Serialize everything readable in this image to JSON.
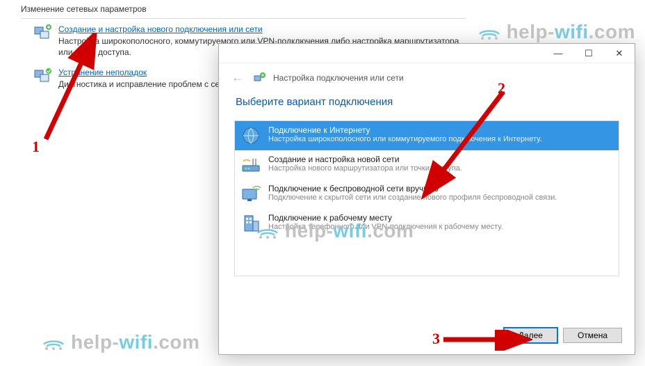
{
  "bg": {
    "heading": "Изменение сетевых параметров",
    "item1": {
      "link": "Создание и настройка нового подключения или сети",
      "desc": "Настройка широкополосного, коммутируемого или VPN-подключения либо настройка маршрутизатора или точки доступа."
    },
    "item2": {
      "link": "Устранение неполадок",
      "desc": "Диагностика и исправление проблем с сетью или получение сведений об устранении неполадок."
    }
  },
  "dialog": {
    "crumb": "Настройка подключения или сети",
    "title": "Выберите вариант подключения",
    "options": [
      {
        "title": "Подключение к Интернету",
        "desc": "Настройка широкополосного или коммутируемого подключения к Интернету.",
        "selected": true
      },
      {
        "title": "Создание и настройка новой сети",
        "desc": "Настройка нового маршрутизатора или точки доступа.",
        "selected": false
      },
      {
        "title": "Подключение к беспроводной сети вручную",
        "desc": "Подключение к скрытой сети или создание нового профиля беспроводной связи.",
        "selected": false
      },
      {
        "title": "Подключение к рабочему месту",
        "desc": "Настройка телефонного или VPN-подключения к рабочему месту.",
        "selected": false
      }
    ],
    "next": "Далее",
    "cancel": "Отмена"
  },
  "annotations": {
    "n1": "1",
    "n2": "2",
    "n3": "3"
  },
  "watermark": {
    "text_a": "help-",
    "text_b": "wifi",
    "text_c": ".com"
  }
}
